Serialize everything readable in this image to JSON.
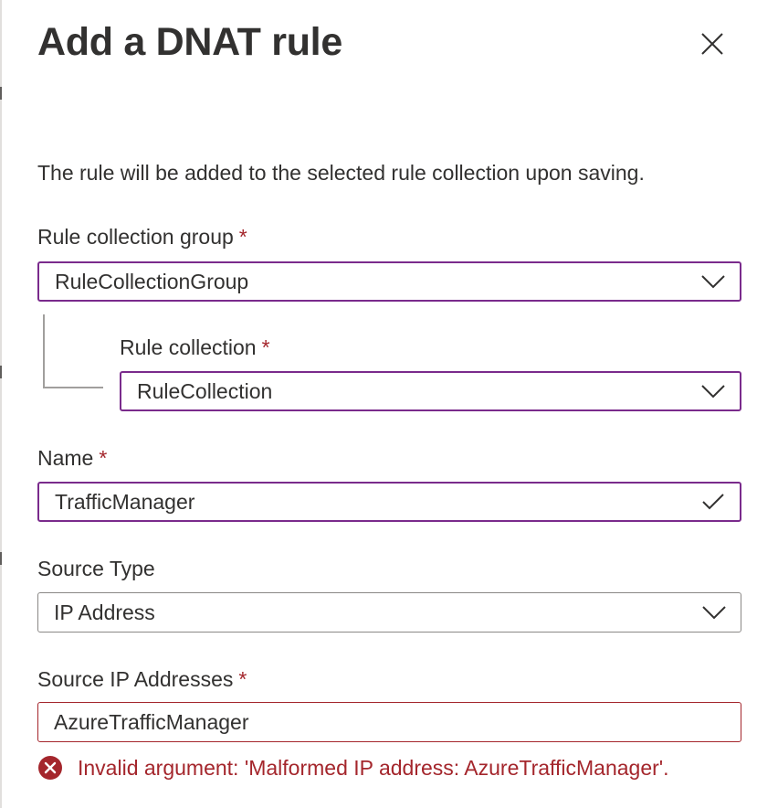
{
  "panel": {
    "title": "Add a DNAT rule",
    "description": "The rule will be added to the selected rule collection upon saving."
  },
  "fields": {
    "rule_collection_group": {
      "label": "Rule collection group",
      "required_marker": "*",
      "value": "RuleCollectionGroup"
    },
    "rule_collection": {
      "label": "Rule collection",
      "required_marker": "*",
      "value": "RuleCollection"
    },
    "name": {
      "label": "Name",
      "required_marker": "*",
      "value": "TrafficManager"
    },
    "source_type": {
      "label": "Source Type",
      "value": "IP Address"
    },
    "source_ip_addresses": {
      "label": "Source IP Addresses",
      "required_marker": "*",
      "value": "AzureTrafficManager",
      "error": "Invalid argument: 'Malformed IP address: AzureTrafficManager'."
    }
  },
  "icons": {
    "close": "close-icon",
    "dropdown": "chevron-down-icon",
    "valid": "checkmark-icon",
    "error": "error-circle-icon"
  },
  "colors": {
    "focus_border": "#7a2b8c",
    "required": "#a4262c",
    "error": "#a4262c",
    "text": "#323130",
    "neutral_border": "#8a8886"
  }
}
